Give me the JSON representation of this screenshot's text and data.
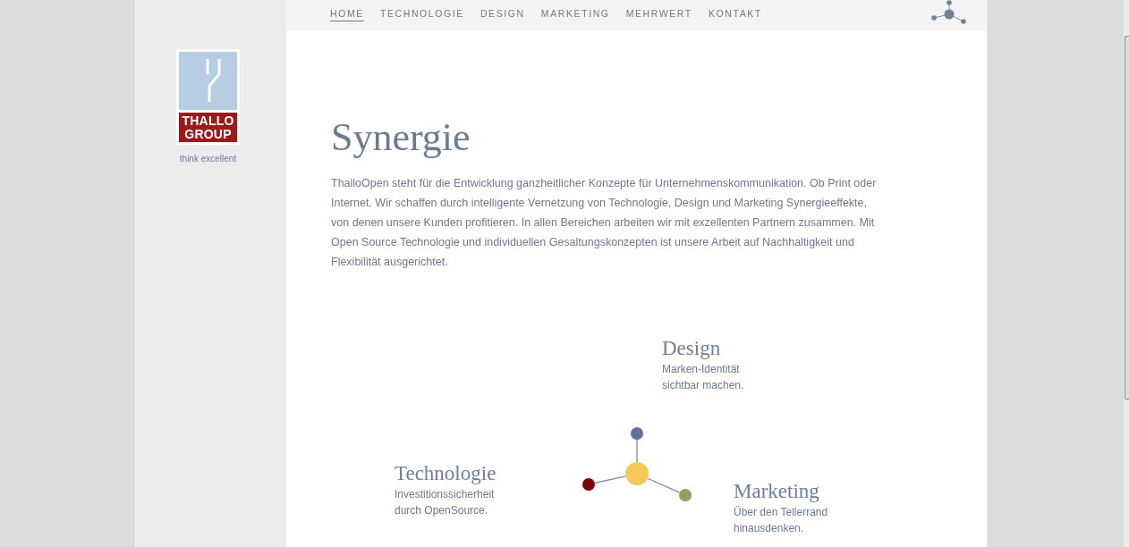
{
  "sidebar": {
    "logo_text": "THALLO GROUP",
    "tagline": "think excellent"
  },
  "nav": {
    "items": [
      {
        "label": "HOME",
        "selected": true
      },
      {
        "label": "TECHNOLOGIE",
        "selected": false
      },
      {
        "label": "DESIGN",
        "selected": false
      },
      {
        "label": "MARKETING",
        "selected": false
      },
      {
        "label": "MEHRWERT",
        "selected": false
      },
      {
        "label": "KONTAKT",
        "selected": false
      }
    ]
  },
  "intro": {
    "title": "Synergie",
    "text": "ThalloOpen steht für die Entwicklung ganzheitlicher Konzepte für Unternehmenskommunikation. Ob Print oder Internet. Wir schaffen durch intelligente Vernetzung von Technologie, Design und Marketing Synergieeffekte, von denen unsere Kunden profitieren. In allen Bereichen arbeiten wir mit exzellenten Partnern zusammen. Mit Open Source Technologie und individuellen Gesaltungskonzepten ist unsere Arbeit auf Nachhaltigkeit und Flexibilität ausgerichtet."
  },
  "diagram": {
    "areas": [
      {
        "title": "Design",
        "text": "Marken-Identität sichtbar machen."
      },
      {
        "title": "Technologie",
        "text": "Investitionssicherheit durch OpenSource."
      },
      {
        "title": "Marketing",
        "text": "Über den Tellerrand hinausdenken."
      }
    ],
    "nodes": [
      {
        "kind": "hub",
        "color": "#f4c95a"
      },
      {
        "kind": "satellite",
        "color": "#646e9f"
      },
      {
        "kind": "satellite",
        "color": "#7f0000"
      },
      {
        "kind": "satellite",
        "color": "#9a9a63"
      }
    ]
  }
}
